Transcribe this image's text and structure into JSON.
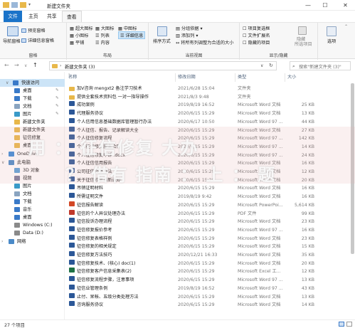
{
  "window": {
    "title": "新建文件夹",
    "minimize_glyph": "—",
    "maximize_glyph": "☐",
    "close_glyph": "✕"
  },
  "menu": {
    "file": "文件",
    "home": "主页",
    "share": "共享",
    "view": "查看"
  },
  "ribbon": {
    "groups": {
      "panes": "窗格",
      "layout": "布局",
      "current_view": "当前视图",
      "show_hide": "显示/隐藏"
    },
    "nav_pane": "导航窗格",
    "preview_pane": "预览窗格",
    "details_pane": "详细信息窗格",
    "layout_items": [
      "超大图标",
      "大图标",
      "中图标",
      "小图标",
      "列表",
      "详细信息",
      "平铺",
      "内容"
    ],
    "sort": "排序方式",
    "group_by": "分组依据",
    "add_column": "添加列",
    "fit_columns": "将所有列调整为合适的大小",
    "item_checkbox": "项目复选框",
    "file_ext": "文件扩展名",
    "hidden_items": "隐藏的项目",
    "hide_selected": "隐藏",
    "hide_selected_2": "所选项目",
    "options": "选项"
  },
  "address": {
    "path": "新建文件夹 (3)",
    "search_placeholder": "搜索\"新建文件夹 (3)\""
  },
  "sidebar": {
    "quick_access": "快速访问",
    "items": [
      {
        "label": "桌面",
        "icon": "desktop-icon",
        "pinned": true
      },
      {
        "label": "下载",
        "icon": "download-icon",
        "pinned": true
      },
      {
        "label": "文档",
        "icon": "document-icon",
        "pinned": true
      },
      {
        "label": "图片",
        "icon": "picture-icon",
        "pinned": true
      },
      {
        "label": "新建文件夹",
        "icon": "folder-icon"
      },
      {
        "label": "新建文件夹",
        "icon": "folder-icon"
      },
      {
        "label": "征信修复",
        "icon": "folder-icon"
      },
      {
        "label": "桌面",
        "icon": "folder-icon"
      }
    ],
    "onedrive": "OneDrive",
    "this_pc": "此电脑",
    "pc_items": [
      {
        "label": "3D 对象",
        "icon": "3d-objects-icon"
      },
      {
        "label": "视频",
        "icon": "video-icon"
      },
      {
        "label": "图片",
        "icon": "picture-icon"
      },
      {
        "label": "文档",
        "icon": "document-icon"
      },
      {
        "label": "下载",
        "icon": "download-icon"
      },
      {
        "label": "音乐",
        "icon": "music-icon"
      },
      {
        "label": "桌面",
        "icon": "desktop-icon"
      },
      {
        "label": "Windows (C:)",
        "icon": "drive-icon"
      },
      {
        "label": "Data (D:)",
        "icon": "drive-icon"
      }
    ],
    "network": "网络"
  },
  "columns": {
    "name": "名称",
    "date": "修改日期",
    "type": "类型",
    "size": "大小"
  },
  "files": [
    {
      "name": "加V咨询  mengxt2  备注学习技术",
      "date": "2021/6/28 15:04",
      "type": "文件夹",
      "size": "",
      "kind": "folder"
    },
    {
      "name": "提供全套技术资料包 一对一指导操作",
      "date": "2021/8/3 9:48",
      "type": "文件夹",
      "size": "",
      "kind": "folder"
    },
    {
      "name": "成功案例",
      "date": "2019/8/19 16:52",
      "type": "Microsoft Word 文档",
      "size": "25 KB",
      "kind": "word"
    },
    {
      "name": "代理服务协议",
      "date": "2020/6/15 15:29",
      "type": "Microsoft Word 文档",
      "size": "13 KB",
      "kind": "word"
    },
    {
      "name": "个人信用信息基础数据库管理暂行办法",
      "date": "2020/6/17 10:50",
      "type": "Microsoft Word 97 ...",
      "size": "44 KB",
      "kind": "word"
    },
    {
      "name": "个人征信、报告、记录解读大全",
      "date": "2020/6/15 15:29",
      "type": "Microsoft Word 文档",
      "size": "27 KB",
      "kind": "word"
    },
    {
      "name": "个人征信修复流程",
      "date": "2020/6/15 15:29",
      "type": "Microsoft Word 97 ...",
      "size": "142 KB",
      "kind": "word"
    },
    {
      "name": "个人征信修复服务合同",
      "date": "2020/6/15 15:29",
      "type": "Microsoft Word 97 ...",
      "size": "14 KB",
      "kind": "word"
    },
    {
      "name": "个人征信修复申诉 .docx",
      "date": "2020/6/15 15:29",
      "type": "Microsoft Word 97 ...",
      "size": "24 KB",
      "kind": "word"
    },
    {
      "name": "个人征信信用报告",
      "date": "2020/6/15 15:29",
      "type": "Microsoft Word 文档",
      "size": "16 KB",
      "kind": "word"
    },
    {
      "name": "公司征信修复办法",
      "date": "2020/6/15 15:29",
      "type": "Microsoft Word 文档",
      "size": "12 KB",
      "kind": "word"
    },
    {
      "name": "关于征信修复最新通知",
      "date": "2020/6/15 15:29",
      "type": "Microsoft Word 文档",
      "size": "20 KB",
      "kind": "word"
    },
    {
      "name": "吊销证明材料",
      "date": "2020/6/15 15:29",
      "type": "Microsoft Word 文档",
      "size": "16 KB",
      "kind": "word"
    },
    {
      "name": "所需证明文件",
      "date": "2019/8/19 9:42",
      "type": "Microsoft Word 文档",
      "size": "16 KB",
      "kind": "word"
    },
    {
      "name": "征信报告解读",
      "date": "2020/6/15 15:29",
      "type": "Microsoft PowerPoi...",
      "size": "5,614 KB",
      "kind": "ppt"
    },
    {
      "name": "征信的个人异议处理办法",
      "date": "2020/6/15 15:29",
      "type": "PDF 文件",
      "size": "99 KB",
      "kind": "pdf"
    },
    {
      "name": "征信投诉办理流程",
      "date": "2020/6/15 15:29",
      "type": "Microsoft Word 文档",
      "size": "23 KB",
      "kind": "word"
    },
    {
      "name": "征信修复报价参考",
      "date": "2020/6/15 15:29",
      "type": "Microsoft Word 97 ...",
      "size": "16 KB",
      "kind": "word"
    },
    {
      "name": "征信修复表格样例",
      "date": "2020/6/15 15:29",
      "type": "Microsoft Word 文档",
      "size": "23 KB",
      "kind": "word"
    },
    {
      "name": "征信修复的相关规定",
      "date": "2020/6/15 15:29",
      "type": "Microsoft Word 文档",
      "size": "15 KB",
      "kind": "word"
    },
    {
      "name": "征信修复方法技巧",
      "date": "2020/12/21 16:33",
      "type": "Microsoft Word 文档",
      "size": "35 KB",
      "kind": "word"
    },
    {
      "name": "征信修复技术、(核心)  doc(1)",
      "date": "2020/6/15 15:29",
      "type": "Microsoft Word 文档",
      "size": "20 KB",
      "kind": "word"
    },
    {
      "name": "征信修复客户信息采集表(2)",
      "date": "2020/6/15 15:29",
      "type": "Microsoft Excel 工...",
      "size": "12 KB",
      "kind": "excel"
    },
    {
      "name": "征信修复流程步骤，注意事项",
      "date": "2020/6/15 15:29",
      "type": "Microsoft Word 97 ...",
      "size": "13 KB",
      "kind": "word"
    },
    {
      "name": "征信业管理条例",
      "date": "2019/8/19 16:52",
      "type": "Microsoft Word 97 ...",
      "size": "43 KB",
      "kind": "word"
    },
    {
      "name": "止付、呆帐、五级分类处理方法",
      "date": "2020/6/15 15:29",
      "type": "Microsoft Word 文档",
      "size": "13 KB",
      "kind": "word"
    },
    {
      "name": "咨询服务协议",
      "date": "2020/6/15 15:29",
      "type": "Microsoft Word 文档",
      "size": "14 KB",
      "kind": "word"
    }
  ],
  "status": {
    "count": "27 个项目"
  },
  "watermark": {
    "line1": "用      ：     征信修复     大办",
    "line2": "？   借有 指南  ：  上   ：   题"
  },
  "colors": {
    "accent": "#1a73c9",
    "folder": "#e8b84a",
    "word": "#2b5797",
    "pdf": "#c0392b",
    "ppt": "#d24726",
    "excel": "#1e7145",
    "selection": "#cce4f7"
  }
}
